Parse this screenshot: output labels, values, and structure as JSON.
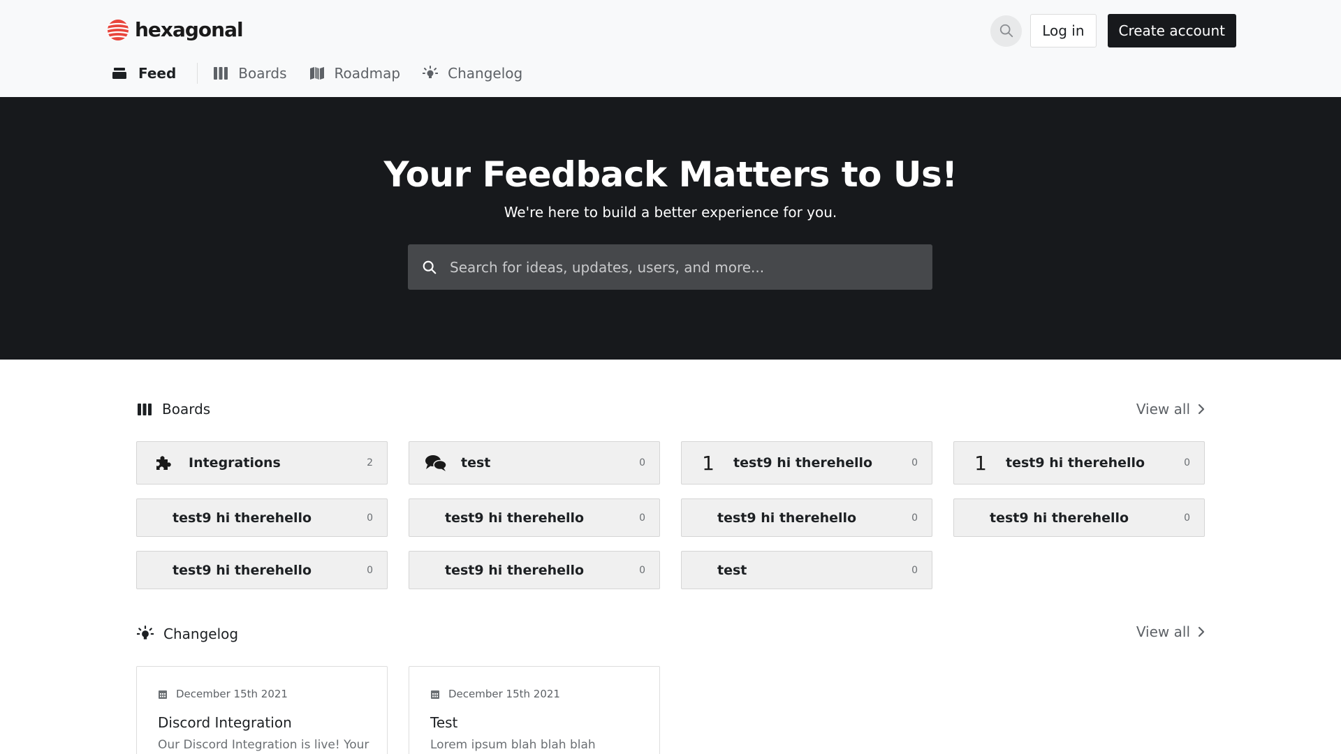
{
  "brand": {
    "name": "hexagonal",
    "accent": "#e8453c"
  },
  "header": {
    "login_label": "Log in",
    "create_label": "Create account"
  },
  "nav": [
    {
      "label": "Feed",
      "icon": "inbox-icon",
      "active": true
    },
    {
      "label": "Boards",
      "icon": "columns-icon",
      "active": false
    },
    {
      "label": "Roadmap",
      "icon": "map-icon",
      "active": false
    },
    {
      "label": "Changelog",
      "icon": "lightbulb-icon",
      "active": false
    }
  ],
  "hero": {
    "title": "Your Feedback Matters to Us!",
    "subtitle": "We're here to build a better experience for you.",
    "search_placeholder": "Search for ideas, updates, users, and more..."
  },
  "boards_section": {
    "title": "Boards",
    "view_all": "View all",
    "items": [
      {
        "label": "Integrations",
        "count": "2",
        "icon": "puzzle-icon"
      },
      {
        "label": "test",
        "count": "0",
        "icon": "comments-icon"
      },
      {
        "label": "test9 hi therehello",
        "count": "0",
        "icon": "1"
      },
      {
        "label": "test9 hi therehello",
        "count": "0",
        "icon": "1"
      },
      {
        "label": "test9 hi therehello",
        "count": "0",
        "icon": ""
      },
      {
        "label": "test9 hi therehello",
        "count": "0",
        "icon": ""
      },
      {
        "label": "test9 hi therehello",
        "count": "0",
        "icon": ""
      },
      {
        "label": "test9 hi therehello",
        "count": "0",
        "icon": ""
      },
      {
        "label": "test9 hi therehello",
        "count": "0",
        "icon": ""
      },
      {
        "label": "test9 hi therehello",
        "count": "0",
        "icon": ""
      },
      {
        "label": "test",
        "count": "0",
        "icon": ""
      }
    ]
  },
  "changelog_section": {
    "title": "Changelog",
    "view_all": "View all",
    "items": [
      {
        "date": "December 15th 2021",
        "title": "Discord Integration",
        "body": "Our Discord Integration is live! Your"
      },
      {
        "date": "December 15th 2021",
        "title": "Test",
        "body": "Lorem ipsum blah blah blah"
      }
    ]
  }
}
